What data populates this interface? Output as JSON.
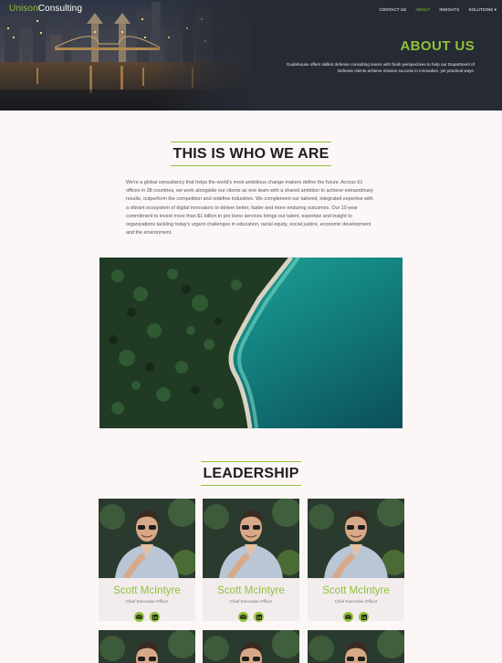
{
  "brand": {
    "first": "Unison",
    "second": "Consulting"
  },
  "nav": {
    "items": [
      {
        "label": "CONTACT US",
        "active": false
      },
      {
        "label": "ABOUT",
        "active": true
      },
      {
        "label": "INSIGHTS",
        "active": false
      },
      {
        "label": "SOLUTIONS ▾",
        "active": false
      }
    ]
  },
  "hero": {
    "title": "ABOUT US",
    "text": "Guidehouse offers skilled defense consulting teams with fresh perspectives to help our Department of Defense clients achieve mission success in innovative, yet practical ways."
  },
  "who": {
    "heading": "THIS IS WHO WE ARE",
    "body": "We're a global consultancy that helps the world's most ambitious change makers define the future. Across 61 offices in 38 countries, we work alongside our clients as one team with a shared ambition to achieve extraordinary results, outperform the competition and redefine industries. We complement our tailored, integrated expertise with a vibrant ecosystem of digital innovators to deliver better, faster and more enduring outcomes. Our 10-year commitment to invest more than $1 billion in pro bono services brings our talent, expertise and insight to organizations tackling today's urgent challenges in education, racial equity, social justice, economic development and the environment."
  },
  "leadership": {
    "heading": "LEADERSHIP",
    "members": [
      {
        "name": "Scott McIntyre",
        "role": "Chief Executive Officer"
      },
      {
        "name": "Scott McIntyre",
        "role": "Chief Executive Officer"
      },
      {
        "name": "Scott McIntyre",
        "role": "Chief Executive Officer"
      }
    ]
  },
  "colors": {
    "accent": "#8fc23b",
    "hero_bg": "#262a33",
    "page_bg": "#fdf6f6"
  },
  "icons": {
    "email": "email-icon",
    "linkedin": "linkedin-icon"
  }
}
